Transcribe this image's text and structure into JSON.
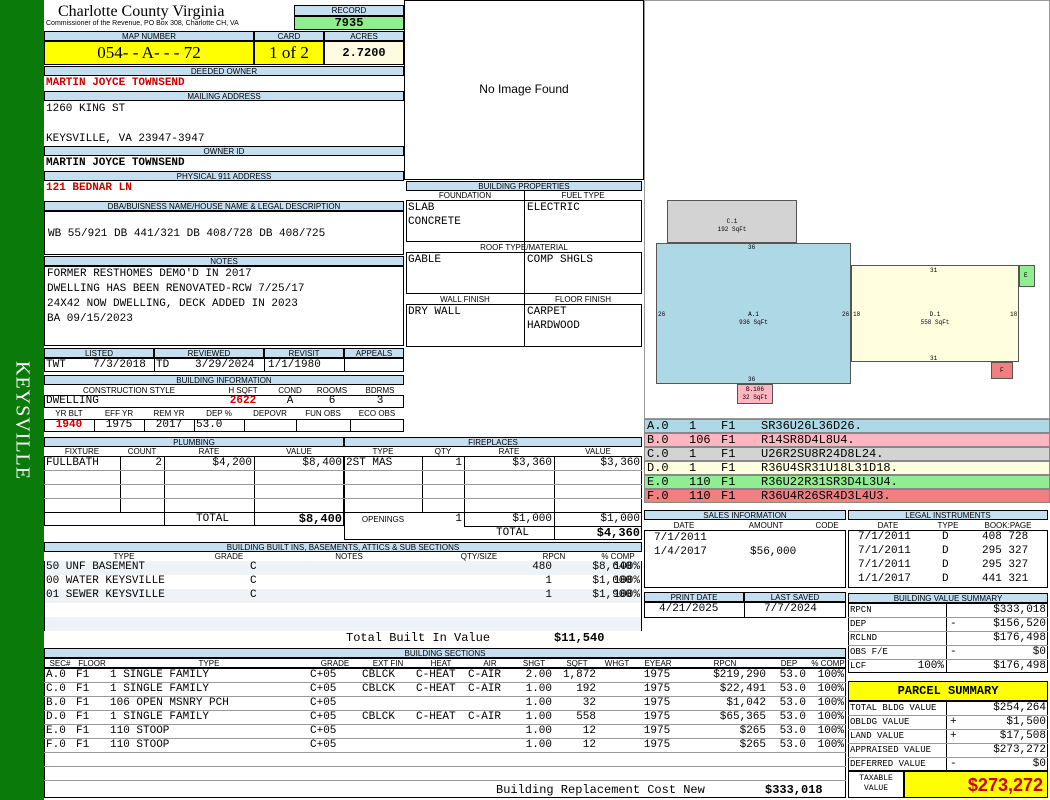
{
  "side_label": "KEYSVILLE",
  "header": {
    "county": "Charlotte County Virginia",
    "commissioner": "Commissioner of the Revenue, PO Box 308, Charlotte CH, VA",
    "record_label": "RECORD",
    "record": "7935",
    "map_label": "MAP NUMBER",
    "map_number": "054- - A- - - 72",
    "card_label": "CARD",
    "card": "1 of 2",
    "acres_label": "ACRES",
    "acres": "2.7200"
  },
  "owner": {
    "deeded_label": "DEEDED OWNER",
    "deeded": "MARTIN JOYCE TOWNSEND",
    "mailing_label": "MAILING ADDRESS",
    "addr1": "1260 KING ST",
    "addr2": "KEYSVILLE, VA 23947-3947",
    "owner_id_label": "OWNER ID",
    "owner_id": "MARTIN JOYCE TOWNSEND",
    "phys_label": "PHYSICAL 911 ADDRESS",
    "phys": "121 BEDNAR LN"
  },
  "dba": {
    "label": "DBA/BUISNESS NAME/HOUSE NAME & LEGAL DESCRIPTION",
    "text": "WB 55/921 DB 441/321 DB 408/728 DB 408/725"
  },
  "notes": {
    "label": "NOTES",
    "lines": [
      "FORMER RESTHOMES DEMO'D IN 2017",
      "DWELLING HAS BEEN RENOVATED-RCW 7/25/17",
      "24X42 NOW DWELLING, DECK ADDED IN 2023",
      "BA 09/15/2023"
    ]
  },
  "dates": {
    "listed_label": "LISTED",
    "listed_by": "TWT",
    "listed": "7/3/2018",
    "reviewed_label": "REVIEWED",
    "reviewed_by": "TD",
    "reviewed": "3/29/2024",
    "revisit_label": "REVISIT",
    "revisit": "1/1/1980",
    "appeals_label": "APPEALS"
  },
  "building_info": {
    "label": "BUILDING INFORMATION",
    "style_label": "CONSTRUCTION STYLE",
    "style": "DWELLING",
    "hsqft_label": "H SQFT",
    "hsqft": "2622",
    "cond_label": "COND",
    "cond": "A",
    "rooms_label": "ROOMS",
    "rooms": "6",
    "bdrms_label": "BDRMS",
    "bdrms": "3",
    "yrblt_label": "YR BLT",
    "yrblt": "1940",
    "effyr_label": "EFF YR",
    "effyr": "1975",
    "remyr_label": "REM YR",
    "remyr": "2017",
    "dep_label": "DEP %",
    "dep": "53.0",
    "depovr_label": "DEPOVR",
    "funobs_label": "FUN OBS",
    "ecoobs_label": "ECO OBS"
  },
  "photo": {
    "text": "No Image Found"
  },
  "props": {
    "label": "BUILDING PROPERTIES",
    "foundation_label": "FOUNDATION",
    "foundation1": "SLAB",
    "foundation2": "CONCRETE",
    "fuel_label": "FUEL TYPE",
    "fuel": "ELECTRIC",
    "roof_label": "ROOF TYPE/MATERIAL",
    "roof_type": "GABLE",
    "roof_mat": "COMP SHGLS",
    "wall_label": "WALL FINISH",
    "wall": "DRY WALL",
    "floor_label": "FLOOR FINISH",
    "floor1": "CARPET",
    "floor2": "HARDWOOD"
  },
  "sketch": {
    "a_label": "A.1",
    "a_area": "936 SqFt",
    "b_label": "B.106",
    "b_area": "32 SqFt",
    "c_label": "C.1",
    "c_area": "192 SqFt",
    "d_label": "D.1",
    "d_area": "558 SqFt",
    "e_label": "E",
    "f_label": "F",
    "dim_36": "36",
    "dim_26": "26",
    "dim_31": "31",
    "dim_18": "18"
  },
  "sketch_codes": [
    {
      "code": "A.0",
      "n": "1",
      "f": "F1",
      "path": "SR36U26L36D26.",
      "color": "#add8e6"
    },
    {
      "code": "B.0",
      "n": "106",
      "f": "F1",
      "path": "R14SR8D4L8U4.",
      "color": "#ffb6c1"
    },
    {
      "code": "C.0",
      "n": "1",
      "f": "F1",
      "path": "U26R2SU8R24D8L24.",
      "color": "#d3d3d3"
    },
    {
      "code": "D.0",
      "n": "1",
      "f": "F1",
      "path": "R36U4SR31U18L31D18.",
      "color": "#ffffe0"
    },
    {
      "code": "E.0",
      "n": "110",
      "f": "F1",
      "path": "R36U22R31SR3D4L3U4.",
      "color": "#90ee90"
    },
    {
      "code": "F.0",
      "n": "110",
      "f": "F1",
      "path": "R36U4R26SR4D3L4U3.",
      "color": "#f08080"
    }
  ],
  "plumbing": {
    "label": "PLUMBING",
    "cols": [
      "FIXTURE",
      "COUNT",
      "RATE",
      "VALUE"
    ],
    "rows": [
      {
        "fixture": "FULLBATH",
        "count": "2",
        "rate": "$4,200",
        "value": "$8,400"
      }
    ],
    "total_label": "TOTAL",
    "total": "$8,400"
  },
  "fireplaces": {
    "label": "FIREPLACES",
    "cols": [
      "TYPE",
      "QTY",
      "RATE",
      "VALUE"
    ],
    "rows": [
      {
        "type": "2ST MAS",
        "qty": "1",
        "rate": "$3,360",
        "value": "$3,360"
      }
    ],
    "openings_label": "OPENINGS",
    "openings_qty": "1",
    "openings_rate": "$1,000",
    "openings_value": "$1,000",
    "total_label": "TOTAL",
    "total": "$4,360"
  },
  "builtins": {
    "label": "BUILDING BUILT INS, BASEMENTS, ATTICS & SUB SECTIONS",
    "cols": [
      "TYPE",
      "GRADE",
      "NOTES",
      "QTY/SIZE",
      "RPCN",
      "% COMP"
    ],
    "rows": [
      {
        "type": "50 UNF BASEMENT",
        "grade": "C",
        "qty": "480",
        "rpcn": "$8,640",
        "pct": "100%"
      },
      {
        "type": "00 WATER KEYSVILLE",
        "grade": "C",
        "qty": "1",
        "rpcn": "$1,000",
        "pct": "100%"
      },
      {
        "type": "01 SEWER KEYSVILLE",
        "grade": "C",
        "qty": "1",
        "rpcn": "$1,900",
        "pct": "100%"
      }
    ],
    "total_label": "Total Built In Value",
    "total": "$11,540"
  },
  "sales": {
    "label": "SALES INFORMATION",
    "cols": [
      "DATE",
      "AMOUNT",
      "CODE"
    ],
    "rows": [
      {
        "date": "7/1/2011",
        "amount": "",
        "code": ""
      },
      {
        "date": "1/4/2017",
        "amount": "$56,000",
        "code": ""
      }
    ]
  },
  "legal": {
    "label": "LEGAL INSTRUMENTS",
    "cols": [
      "DATE",
      "TYPE",
      "BOOK:PAGE"
    ],
    "rows": [
      {
        "date": "7/1/2011",
        "type": "D",
        "bp": "408 728"
      },
      {
        "date": "7/1/2011",
        "type": "D",
        "bp": "295 327"
      },
      {
        "date": "7/1/2011",
        "type": "D",
        "bp": "295 327"
      },
      {
        "date": "1/1/2017",
        "type": "D",
        "bp": "441 321"
      }
    ]
  },
  "print": {
    "print_label": "PRINT DATE",
    "print_date": "4/21/2025",
    "saved_label": "LAST SAVED",
    "saved_date": "7/7/2024"
  },
  "bvs": {
    "label": "BUILDING VALUE SUMMARY",
    "rpcn_label": "RPCN",
    "rpcn": "$333,018",
    "dep_label": "DEP",
    "dep_sign": "-",
    "dep": "$156,520",
    "rclnd_label": "RCLND",
    "rclnd": "$176,498",
    "obs_label": "OBS F/E",
    "obs_sign": "-",
    "obs": "$0",
    "lcr_label": "LCF",
    "lcr_pct": "100%",
    "lcr": "$176,498"
  },
  "parcel": {
    "label": "PARCEL SUMMARY",
    "tbv_label": "TOTAL BLDG VALUE",
    "tbv": "$254,264",
    "obv_label": "OBLDG VALUE",
    "obv_sign": "+",
    "obv": "$1,500",
    "land_label": "LAND VALUE",
    "land_sign": "+",
    "land": "$17,508",
    "appr_label": "APPRAISED VALUE",
    "appr": "$273,272",
    "def_label": "DEFERRED VALUE",
    "def_sign": "-",
    "def": "$0",
    "taxable_label1": "TAXABLE",
    "taxable_label2": "VALUE",
    "taxable": "$273,272"
  },
  "sections": {
    "label": "BUILDING SECTIONS",
    "cols": [
      "SEC#",
      "FLOOR",
      "TYPE",
      "GRADE",
      "EXT FIN",
      "HEAT",
      "AIR",
      "SHGT",
      "SQFT",
      "WHGT",
      "EYEAR",
      "RPCN",
      "DEP",
      "% COMP"
    ],
    "rows": [
      {
        "sec": "A.0",
        "floor": "F1",
        "type": "1 SINGLE FAMILY",
        "grade": "C+05",
        "ext": "CBLCK",
        "heat": "C-HEAT",
        "air": "C-AIR",
        "shgt": "2.00",
        "sqft": "1,872",
        "eyear": "1975",
        "rpcn": "$219,290",
        "dep": "53.0",
        "pct": "100%"
      },
      {
        "sec": "C.0",
        "floor": "F1",
        "type": "1 SINGLE FAMILY",
        "grade": "C+05",
        "ext": "CBLCK",
        "heat": "C-HEAT",
        "air": "C-AIR",
        "shgt": "1.00",
        "sqft": "192",
        "eyear": "1975",
        "rpcn": "$22,491",
        "dep": "53.0",
        "pct": "100%"
      },
      {
        "sec": "B.0",
        "floor": "F1",
        "type": "106 OPEN MSNRY PCH",
        "grade": "C+05",
        "ext": "",
        "heat": "",
        "air": "",
        "shgt": "1.00",
        "sqft": "32",
        "eyear": "1975",
        "rpcn": "$1,042",
        "dep": "53.0",
        "pct": "100%"
      },
      {
        "sec": "D.0",
        "floor": "F1",
        "type": "1 SINGLE FAMILY",
        "grade": "C+05",
        "ext": "CBLCK",
        "heat": "C-HEAT",
        "air": "C-AIR",
        "shgt": "1.00",
        "sqft": "558",
        "eyear": "1975",
        "rpcn": "$65,365",
        "dep": "53.0",
        "pct": "100%"
      },
      {
        "sec": "E.0",
        "floor": "F1",
        "type": "110 STOOP",
        "grade": "C+05",
        "ext": "",
        "heat": "",
        "air": "",
        "shgt": "1.00",
        "sqft": "12",
        "eyear": "1975",
        "rpcn": "$265",
        "dep": "53.0",
        "pct": "100%"
      },
      {
        "sec": "F.0",
        "floor": "F1",
        "type": "110 STOOP",
        "grade": "C+05",
        "ext": "",
        "heat": "",
        "air": "",
        "shgt": "1.00",
        "sqft": "12",
        "eyear": "1975",
        "rpcn": "$265",
        "dep": "53.0",
        "pct": "100%"
      }
    ],
    "total_label": "Building Replacement Cost New",
    "total": "$333,018"
  }
}
